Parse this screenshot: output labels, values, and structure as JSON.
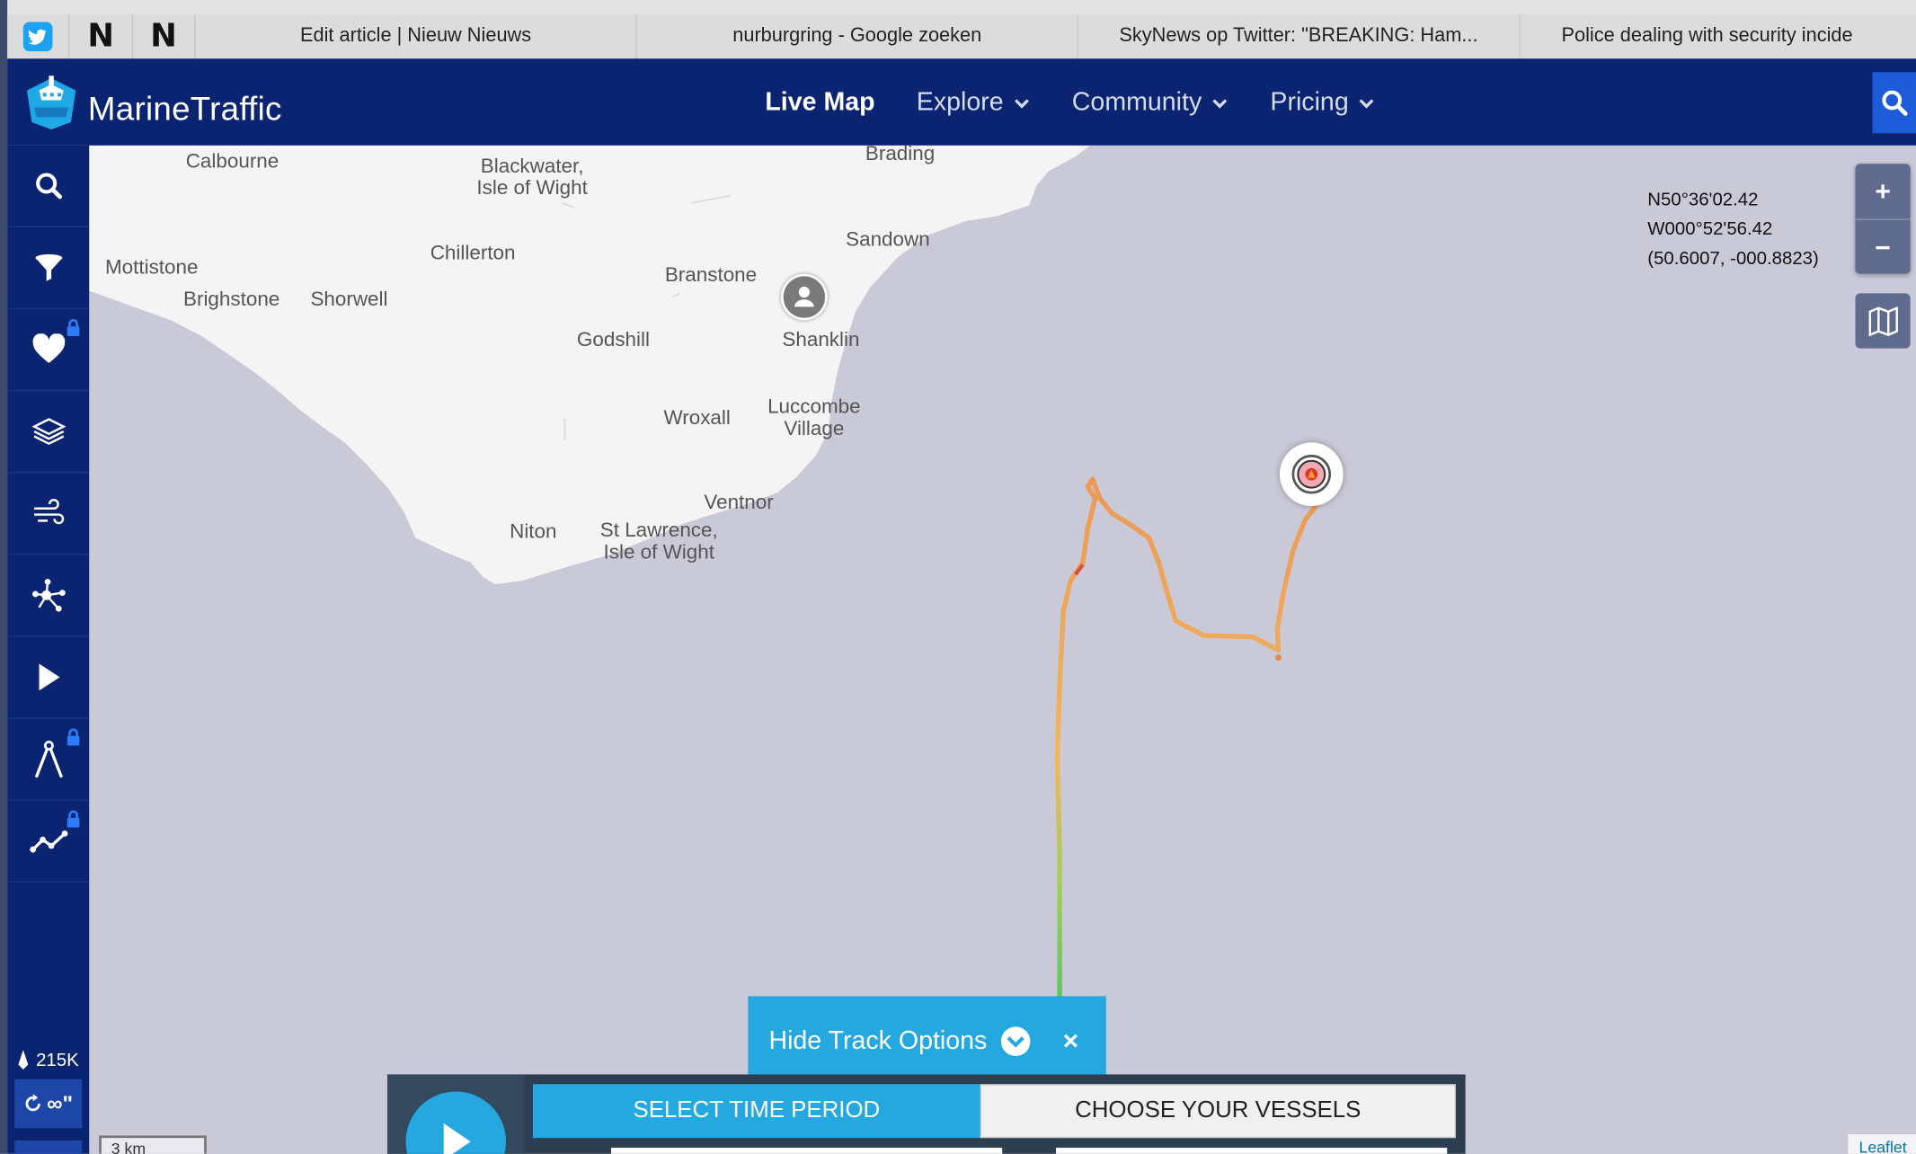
{
  "browser": {
    "tabs": [
      {
        "label": "Edit article | Nieuw Nieuws"
      },
      {
        "label": "nurburgring - Google zoeken"
      },
      {
        "label": "SkyNews op Twitter: \"BREAKING: Ham..."
      },
      {
        "label": "Police dealing with security incide"
      }
    ],
    "pinned": [
      {
        "icon": "twitter-icon",
        "label": ""
      },
      {
        "icon": "nieuw-nieuws-icon",
        "label": "N"
      },
      {
        "icon": "nieuw-nieuws-icon",
        "label": "N"
      }
    ]
  },
  "header": {
    "brand": "MarineTraffic",
    "nav": [
      {
        "label": "Live Map",
        "active": true
      },
      {
        "label": "Explore",
        "dropdown": true
      },
      {
        "label": "Community",
        "dropdown": true
      },
      {
        "label": "Pricing",
        "dropdown": true
      }
    ]
  },
  "sidebar": {
    "items": [
      {
        "icon": "search-icon"
      },
      {
        "icon": "filter-icon"
      },
      {
        "icon": "heart-icon",
        "locked": true
      },
      {
        "icon": "layers-icon"
      },
      {
        "icon": "wind-icon"
      },
      {
        "icon": "network-icon"
      },
      {
        "icon": "play-icon"
      },
      {
        "icon": "compass-icon",
        "locked": true
      },
      {
        "icon": "chart-line-icon",
        "locked": true
      }
    ],
    "vessel_count": "215K",
    "refresh_label": "∞\""
  },
  "map": {
    "place_labels": [
      {
        "name": "Calbourne"
      },
      {
        "name": "Blackwater,\nIsle of Wight"
      },
      {
        "name": "Brading"
      },
      {
        "name": "Sandown"
      },
      {
        "name": "Chillerton"
      },
      {
        "name": "Branstone"
      },
      {
        "name": "Mottistone"
      },
      {
        "name": "Brighstone"
      },
      {
        "name": "Shorwell"
      },
      {
        "name": "Godshill"
      },
      {
        "name": "Shanklin"
      },
      {
        "name": "Luccombe\nVillage"
      },
      {
        "name": "Wroxall"
      },
      {
        "name": "Ventnor"
      },
      {
        "name": "Niton"
      },
      {
        "name": "St Lawrence,\nIsle of Wight"
      }
    ],
    "coords": {
      "lat_dms": "N50°36'02.42",
      "lon_dms": "W000°52'56.42",
      "decimal": "(50.6007, -000.8823)"
    },
    "zoom_in": "+",
    "zoom_out": "−",
    "scale_label": "3 km",
    "attribution": "Leaflet"
  },
  "track": {
    "hide_label": "Hide Track Options",
    "close_label": "×",
    "select_time": "SELECT TIME PERIOD",
    "choose_vessels": "CHOOSE YOUR VESSELS"
  },
  "colors": {
    "navy": "#0a2472",
    "accent": "#25a8e0",
    "sea": "#c9c9d8",
    "land": "#f4f4f4"
  }
}
